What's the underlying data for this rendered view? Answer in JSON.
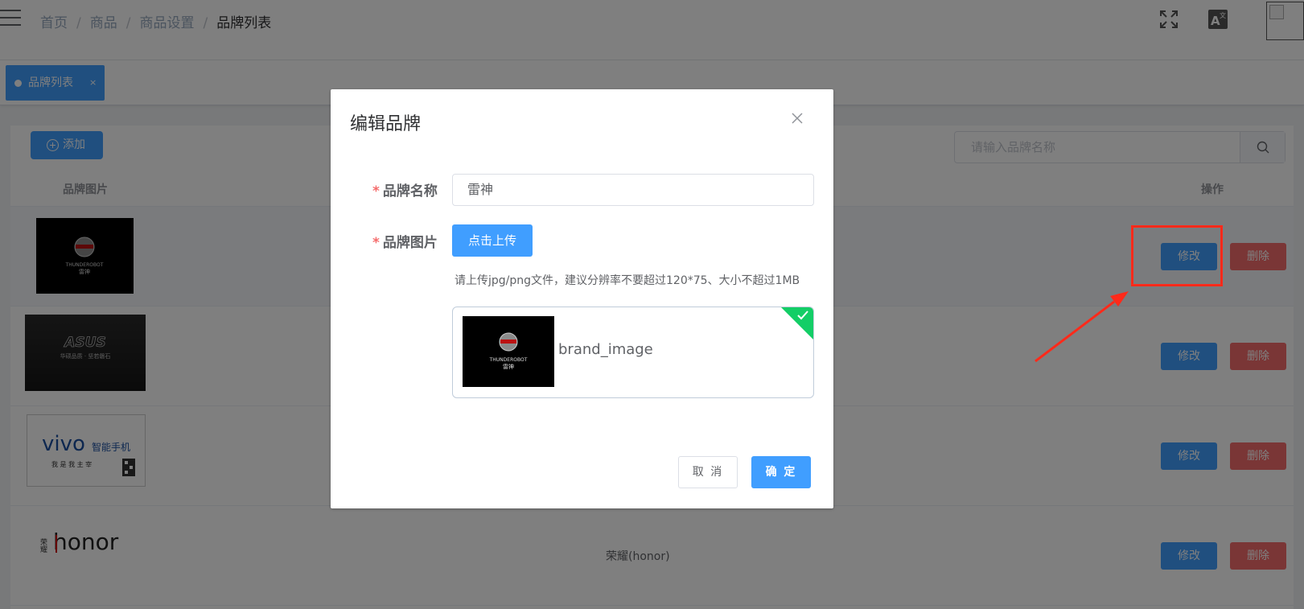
{
  "breadcrumb": [
    "首页",
    "商品",
    "商品设置",
    "品牌列表"
  ],
  "tags": [
    {
      "label": "品牌列表",
      "close": "×"
    }
  ],
  "toolbar": {
    "add_label": "添加",
    "search_placeholder": "请输入品牌名称"
  },
  "table": {
    "columns": {
      "image": "品牌图片",
      "operation": "操作"
    },
    "rows": [
      {
        "logo": "thunderobot",
        "name": "",
        "edit": "修改",
        "delete": "删除"
      },
      {
        "logo": "asus",
        "name": "",
        "edit": "修改",
        "delete": "删除"
      },
      {
        "logo": "vivo",
        "name": "",
        "edit": "修改",
        "delete": "删除"
      },
      {
        "logo": "honor",
        "name": "荣耀(honor)",
        "edit": "修改",
        "delete": "删除"
      }
    ]
  },
  "logos": {
    "thunder": {
      "word": "THUNDEROBOT",
      "sub": "雷神"
    },
    "asus": {
      "word": "ASUS",
      "sub": "华硕品质 · 坚若磐石"
    },
    "vivo": {
      "word": "vivo",
      "sub": "智能手机",
      "slogan": "我 是 我 主 宰"
    },
    "honor": {
      "word": "honor",
      "cn": "荣耀"
    }
  },
  "dialog": {
    "title": "编辑品牌",
    "name_label": "品牌名称",
    "name_value": "雷神",
    "image_label": "品牌图片",
    "upload_label": "点击上传",
    "tip": "请上传jpg/png文件，建议分辨率不要超过120*75、大小不超过1MB",
    "file_name": "brand_image",
    "cancel": "取 消",
    "confirm": "确 定"
  },
  "colors": {
    "primary": "#409eff",
    "danger": "#f56c6c",
    "success": "#13ce66",
    "annotation": "#ff2a1a"
  }
}
